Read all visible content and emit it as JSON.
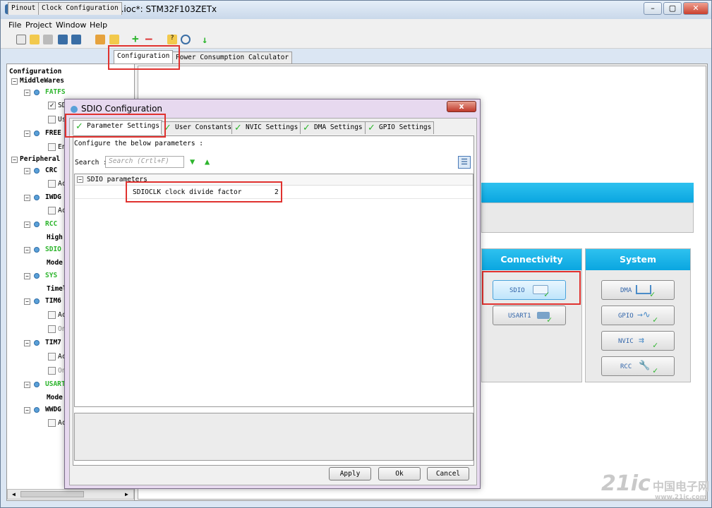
{
  "window": {
    "title": "STM32CubeMX YS-F1Pro.ioc*: STM32F103ZETx",
    "minimize": "–",
    "restore": "▢",
    "close": "✕"
  },
  "menu": [
    "File",
    "Project",
    "Window",
    "Help"
  ],
  "main_tabs": [
    "Pinout",
    "Clock Configuration",
    "Configuration",
    "Power Consumption Calculator"
  ],
  "tree": {
    "root": "Configuration",
    "middlewares": "MiddleWares",
    "fatfs": "FATFS",
    "fatfs_sd": "SD",
    "fatfs_us": "Us",
    "freertos": "FREE",
    "freertos_en": "En",
    "peripherals": "Peripheral",
    "crc": "CRC",
    "crc_ac": "Ac",
    "iwdg": "IWDG",
    "iwdg_ac": "Ac",
    "rcc": "RCC",
    "rcc_high": "High",
    "sdio": "SDIO",
    "sdio_mode": "Mode",
    "sys": "SYS",
    "sys_time": "Timel",
    "tim6": "TIM6",
    "tim6_ac": "Ac",
    "tim6_on": "On",
    "tim7": "TIM7",
    "tim7_ac": "Ac",
    "tim7_on": "On",
    "usart": "USART",
    "usart_mode": "Mode",
    "wwdg": "WWDG",
    "wwdg_ac": "Ac"
  },
  "dialog": {
    "title": "SDIO Configuration",
    "close": "x",
    "tabs": [
      "Parameter Settings",
      "User Constants",
      "NVIC Settings",
      "DMA Settings",
      "GPIO Settings"
    ],
    "instruction": "Configure the below parameters :",
    "search_label": "Search :",
    "search_placeholder": "Search (Crtl+F)",
    "group": "SDIO parameters",
    "param_name": "SDIOCLK clock divide factor",
    "param_value": "2",
    "buttons": {
      "apply": "Apply",
      "ok": "Ok",
      "cancel": "Cancel"
    }
  },
  "right_panel": {
    "connectivity_header": "Connectivity",
    "system_header": "System",
    "connectivity_buttons": [
      "SDIO",
      "USART1"
    ],
    "system_buttons": [
      "DMA",
      "GPIO",
      "NVIC",
      "RCC"
    ],
    "colors": {
      "header": "#0aa6e0",
      "highlight": "#e0322f"
    }
  },
  "watermark": {
    "brand": "21ic",
    "cn": "中国电子网",
    "url": "www.21ic.com"
  }
}
